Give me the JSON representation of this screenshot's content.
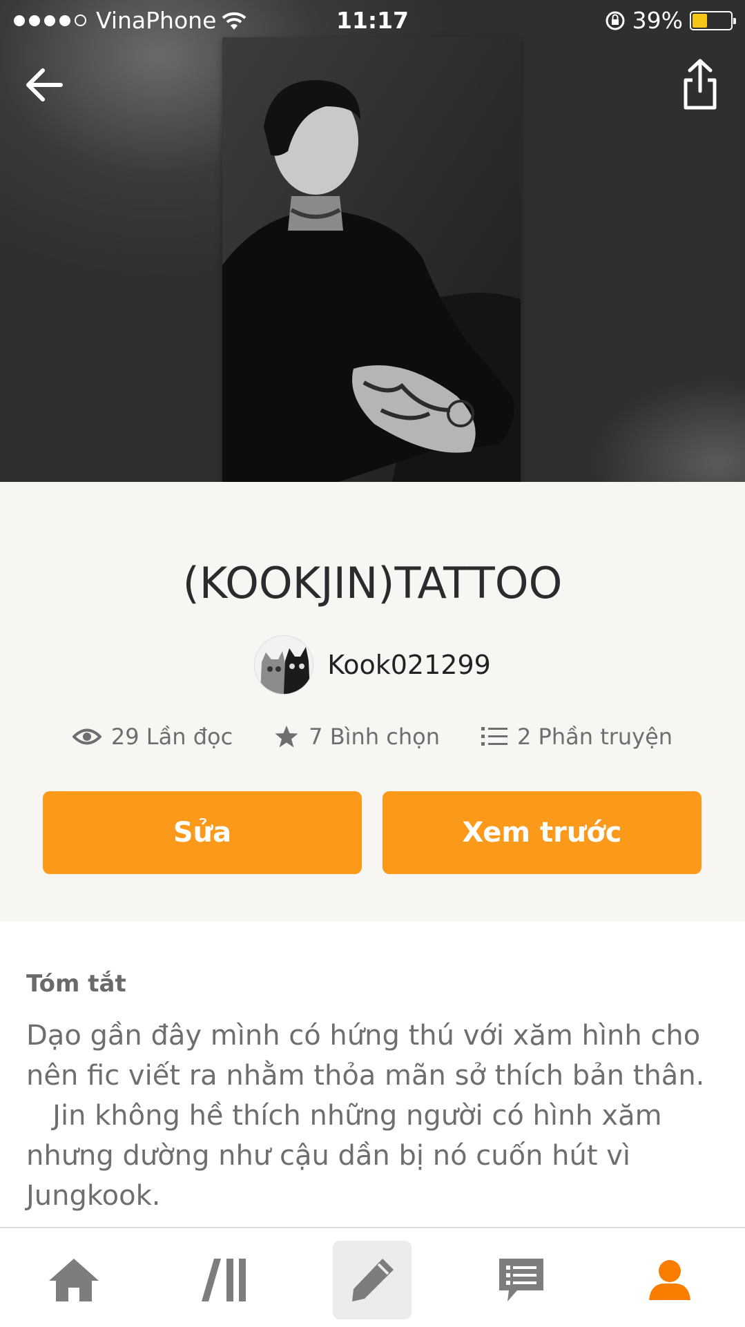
{
  "status_bar": {
    "carrier": "VinaPhone",
    "time": "11:17",
    "battery_percent": "39%",
    "battery_level": 0.39,
    "battery_color": "#f5c518"
  },
  "header": {
    "back_icon": "arrow-left-icon",
    "share_icon": "share-icon"
  },
  "story": {
    "title": "(KOOKJIN)TATTOO",
    "author": "Kook021299",
    "stats": {
      "reads": "29 Lần đọc",
      "votes": "7 Bình chọn",
      "parts": "2 Phần truyện"
    },
    "edit_label": "Sửa",
    "preview_label": "Xem trước",
    "summary_title": "Tóm tắt",
    "summary_text": "Dạo gần đây mình có hứng thú với xăm hình cho nên fic viết ra nhằm thỏa mãn sở thích bản thân.\n   Jin không hề thích những người có hình xăm nhưng dường như cậu dần bị nó cuốn hút vì Jungkook."
  },
  "bottom_nav": {
    "items": [
      {
        "icon": "home-icon"
      },
      {
        "icon": "library-icon"
      },
      {
        "icon": "pencil-icon"
      },
      {
        "icon": "messages-icon"
      },
      {
        "icon": "profile-icon"
      }
    ],
    "active_index": 2,
    "accent": "#fb7d00"
  },
  "colors": {
    "button": "#fb9a1a",
    "icon_gray": "#7d7d7d"
  }
}
